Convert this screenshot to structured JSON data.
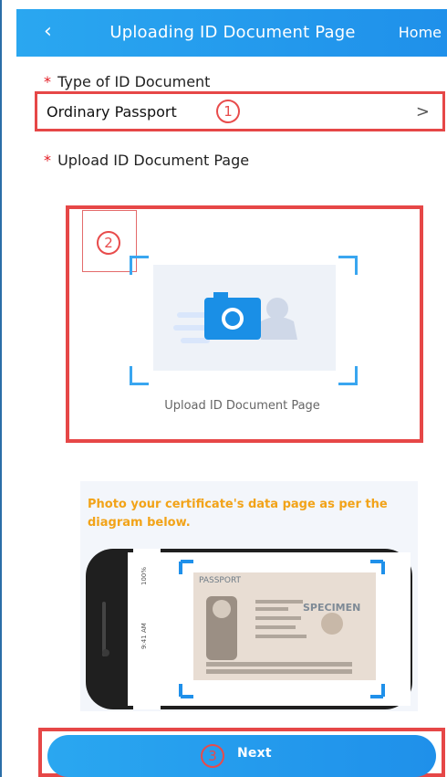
{
  "header": {
    "back_icon": "chevron-left-icon",
    "title": "Uploading ID Document Page",
    "home": "Home"
  },
  "form": {
    "required_mark": "*",
    "type_label": "Type of ID Document",
    "type_value": "Ordinary Passport",
    "type_chevron": ">",
    "upload_label": "Upload ID Document Page",
    "upload_caption": "Upload ID Document Page"
  },
  "annotations": {
    "marker_1": "1",
    "marker_2": "2",
    "marker_3": "3",
    "color": "#e64747"
  },
  "diagram": {
    "instruction": "Photo your certificate's data page as per the diagram below.",
    "passport_word": "PASSPORT",
    "specimen_word": "SPECIMEN"
  },
  "footer": {
    "next_label": "Next"
  },
  "colors": {
    "accent": "#1f90ea",
    "annotation": "#e64747",
    "instruction_text": "#f2a318"
  }
}
